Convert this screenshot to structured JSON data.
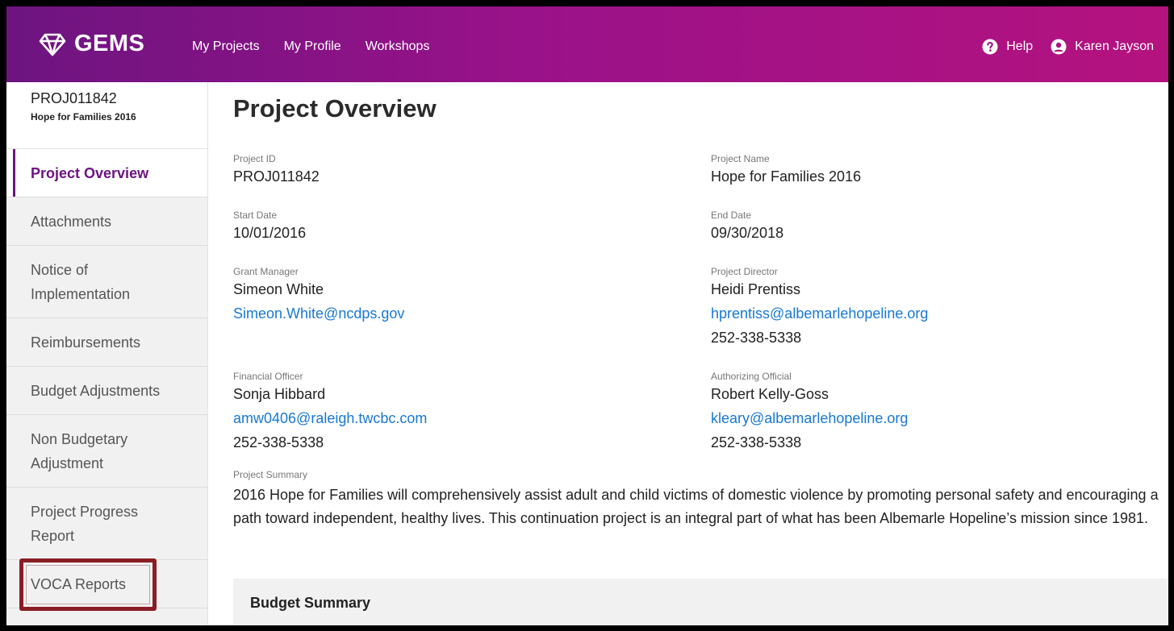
{
  "brand": {
    "name": "GEMS"
  },
  "nav": [
    "My Projects",
    "My Profile",
    "Workshops"
  ],
  "topright": {
    "help": "Help",
    "user": "Karen Jayson"
  },
  "project": {
    "id": "PROJ011842",
    "name": "Hope for Families 2016"
  },
  "sidebar": {
    "items": [
      {
        "label": "Project Overview"
      },
      {
        "label": "Attachments"
      },
      {
        "label": "Notice of Implementation"
      },
      {
        "label": "Reimbursements"
      },
      {
        "label": "Budget Adjustments"
      },
      {
        "label": "Non Budgetary Adjustment"
      },
      {
        "label": "Project Progress Report"
      },
      {
        "label": "VOCA Reports"
      }
    ]
  },
  "main": {
    "title": "Project Overview",
    "project_id": {
      "label": "Project ID",
      "value": "PROJ011842"
    },
    "project_name": {
      "label": "Project Name",
      "value": "Hope for Families 2016"
    },
    "start_date": {
      "label": "Start Date",
      "value": "10/01/2016"
    },
    "end_date": {
      "label": "End Date",
      "value": "09/30/2018"
    },
    "grant_manager": {
      "label": "Grant Manager",
      "name": "Simeon White",
      "email": "Simeon.White@ncdps.gov"
    },
    "project_director": {
      "label": "Project Director",
      "name": "Heidi Prentiss",
      "email": "hprentiss@albemarlehopeline.org",
      "phone": "252-338-5338"
    },
    "financial_officer": {
      "label": "Financial Officer",
      "name": "Sonja Hibbard",
      "email": "amw0406@raleigh.twcbc.com",
      "phone": "252-338-5338"
    },
    "authorizing_official": {
      "label": "Authorizing Official",
      "name": "Robert Kelly-Goss",
      "email": "kleary@albemarlehopeline.org",
      "phone": "252-338-5338"
    },
    "summary": {
      "label": "Project Summary",
      "text": "2016 Hope for Families will comprehensively assist adult and child victims of domestic violence by promoting personal safety and encouraging a path toward independent, healthy lives. This continuation project is an integral part of what has been Albemarle Hopeline’s mission since 1981."
    },
    "budget_summary": "Budget Summary"
  },
  "colors": {
    "brand_start": "#6d1480",
    "brand_end": "#b4127f",
    "link": "#1778d4",
    "highlight": "#8a1c24"
  }
}
